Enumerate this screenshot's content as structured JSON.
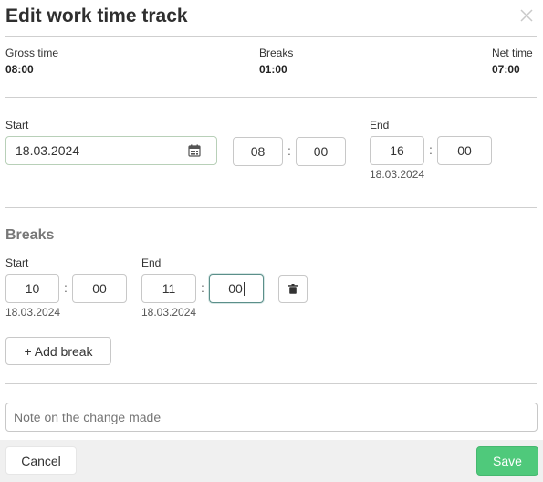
{
  "dialog": {
    "title": "Edit work time track"
  },
  "summary": {
    "gross_label": "Gross time",
    "gross_value": "08:00",
    "breaks_label": "Breaks",
    "breaks_value": "01:00",
    "net_label": "Net time",
    "net_value": "07:00"
  },
  "work": {
    "start_label": "Start",
    "start_date": "18.03.2024",
    "start_hour": "08",
    "start_minute": "00",
    "end_label": "End",
    "end_hour": "16",
    "end_minute": "00",
    "end_date": "18.03.2024"
  },
  "breaks": {
    "section_title": "Breaks",
    "items": [
      {
        "start_label": "Start",
        "start_hour": "10",
        "start_minute": "00",
        "start_date": "18.03.2024",
        "end_label": "End",
        "end_hour": "11",
        "end_minute": "00",
        "end_date": "18.03.2024"
      }
    ],
    "add_label": "+ Add break"
  },
  "note": {
    "placeholder": "Note on the change made"
  },
  "footer": {
    "cancel_label": "Cancel",
    "save_label": "Save"
  },
  "colors": {
    "save": "#4fc97b",
    "focus": "#5b8f8a"
  },
  "icons": [
    "close-icon",
    "calendar-icon",
    "trash-icon"
  ]
}
